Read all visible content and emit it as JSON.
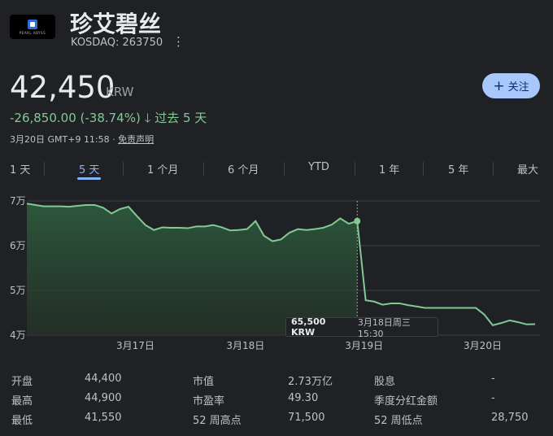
{
  "header": {
    "logo_text": "PEARL ABYSS",
    "company": "珍艾碧丝",
    "ticker": "KOSDAQ: 263750",
    "more_icon": "⋮"
  },
  "price": {
    "value": "42,450",
    "currency": "KRW",
    "follow_label": "关注",
    "change": "-26,850.00 (-38.74%)",
    "arrow": "🡓",
    "period": "过去 5 天",
    "timestamp": "3月20日 GMT+9 11:58 · ",
    "disclaimer": "免责声明"
  },
  "ranges": [
    "1 天",
    "5 天",
    "1 个月",
    "6 个月",
    "YTD",
    "1 年",
    "5 年",
    "最大"
  ],
  "active_range": "5 天",
  "tooltip": {
    "value": "65,500 KRW",
    "time": "3月18日周三 15:30"
  },
  "colors": {
    "accent": "#8ab4f8",
    "positive_line": "#81c995",
    "button_bg": "#a8c7fa"
  },
  "chart_data": {
    "type": "area",
    "ylim": [
      40000,
      70000
    ],
    "y_ticks": [
      70000,
      60000,
      50000,
      40000
    ],
    "y_tick_labels": [
      "7万",
      "6万",
      "5万",
      "4万"
    ],
    "x_tick_labels": [
      "3月17日",
      "3月18日",
      "3月19日",
      "3月20日"
    ],
    "highlight_value": 65500,
    "values": [
      69400,
      69100,
      68800,
      68800,
      68800,
      68700,
      68900,
      69100,
      69100,
      68500,
      67200,
      68200,
      68700,
      66600,
      64600,
      63500,
      64100,
      64000,
      64000,
      63900,
      64300,
      64300,
      64600,
      64100,
      63400,
      63500,
      63700,
      65500,
      62200,
      61000,
      61400,
      62900,
      63700,
      63500,
      63700,
      64000,
      64700,
      66100,
      64900,
      65500,
      47800,
      47500,
      46800,
      47100,
      47100,
      46700,
      46400,
      46100,
      46100,
      46100,
      46100,
      46100,
      46100,
      46100,
      44600,
      42200,
      42700,
      43300,
      42900,
      42400,
      42450
    ]
  },
  "stats": {
    "col1": [
      {
        "label": "开盘",
        "value": "44,400"
      },
      {
        "label": "最高",
        "value": "44,900"
      },
      {
        "label": "最低",
        "value": "41,550"
      }
    ],
    "col2": [
      {
        "label": "市值",
        "value": "2.73万亿"
      },
      {
        "label": "市盈率",
        "value": "49.30"
      },
      {
        "label": "52 周高点",
        "value": "71,500"
      }
    ],
    "col3": [
      {
        "label": "股息",
        "value": "-"
      },
      {
        "label": "季度分红金额",
        "value": "-"
      },
      {
        "label": "52 周低点",
        "value": "28,750"
      }
    ]
  }
}
